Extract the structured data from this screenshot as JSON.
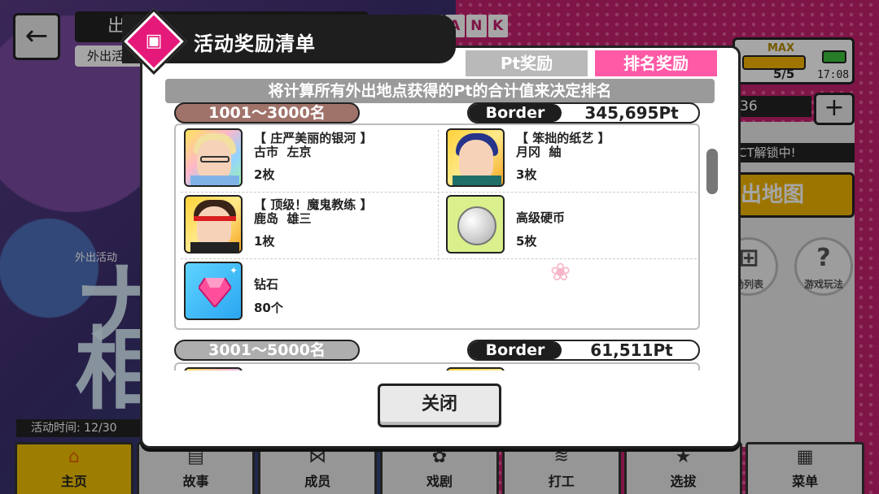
{
  "background": {
    "back_icon": "arrow-left-icon",
    "title_partial": "出活动(夏)首页",
    "subtab_partial": "外出活动",
    "rank_letters": [
      "R",
      "A",
      "N",
      "K"
    ],
    "stamina_label": "MAX",
    "stamina_value": "5/5",
    "clock": "17:08",
    "count_partial": "36",
    "unlock_text": "CT解锁中!",
    "map_button_partial": "出地图",
    "circle_buttons": [
      {
        "icon": "gift-icon",
        "label": "励列表"
      },
      {
        "icon": "question-icon",
        "glyph": "?",
        "label": "游戏玩法"
      }
    ],
    "event_small_label": "外出活动",
    "event_period": "活动时间: 12/30",
    "big_glyphs": [
      "ナ",
      "相"
    ]
  },
  "bottom_nav": [
    {
      "label": "主页",
      "icon": "home-icon",
      "glyph": "⌂",
      "active": true
    },
    {
      "label": "故事",
      "icon": "book-icon",
      "glyph": "▤"
    },
    {
      "label": "成员",
      "icon": "bow-tie-icon",
      "glyph": "⋈"
    },
    {
      "label": "戏剧",
      "icon": "stage-icon",
      "glyph": "✿"
    },
    {
      "label": "打工",
      "icon": "coins-icon",
      "glyph": "≋"
    },
    {
      "label": "选拔",
      "icon": "star-badge-icon",
      "glyph": "★"
    },
    {
      "label": "菜单",
      "icon": "grid-menu-icon",
      "glyph": "▦"
    }
  ],
  "modal": {
    "title": "活动奖励清单",
    "tabs": [
      {
        "label": "Pt奖励",
        "active": false
      },
      {
        "label": "排名奖励",
        "active": true
      }
    ],
    "banner": "将计算所有外出地点获得的Pt的合计值来决定排名",
    "tiers": [
      {
        "range": "1001～3000名",
        "border_label": "Border",
        "border_value": "345,695Pt",
        "rewards": [
          {
            "name": "【 庄严美丽的银河 】\n古市  左京",
            "qty": "2枚",
            "icon": "card-portrait-icon"
          },
          {
            "name": "【 笨拙的纸艺 】\n月冈  紬",
            "qty": "3枚",
            "icon": "card-portrait-icon"
          },
          {
            "name": "【 顶级！魔鬼教练 】\n鹿岛  雄三",
            "qty": "1枚",
            "icon": "card-portrait-icon"
          },
          {
            "name": "高级硬币",
            "qty": "5枚",
            "icon": "coin-icon"
          },
          {
            "name": "钻石",
            "qty": "80个",
            "icon": "diamond-icon"
          }
        ]
      },
      {
        "range": "3001～5000名",
        "border_label": "Border",
        "border_value": "61,511Pt",
        "rewards": []
      }
    ],
    "close_label": "关闭"
  },
  "colors": {
    "accent_pink": "#ff5aa6",
    "badge_magenta": "#e5197a",
    "tier1_brown": "#a0736a",
    "tier2_gray": "#aeaeae",
    "nav_active": "#f2c200"
  }
}
